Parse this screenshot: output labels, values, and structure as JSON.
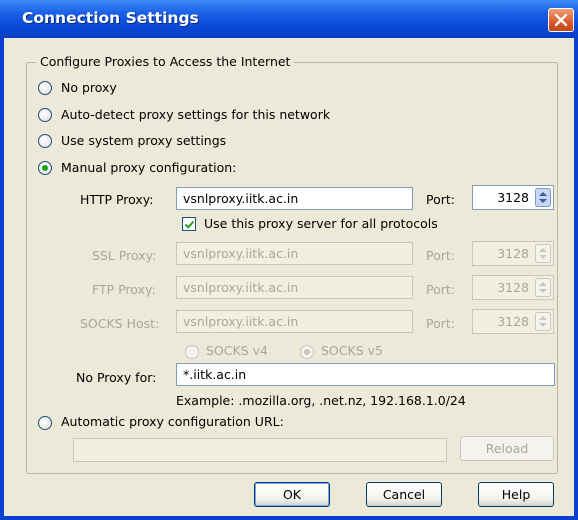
{
  "window": {
    "title": "Connection Settings"
  },
  "group": {
    "legend": "Configure Proxies to Access the Internet"
  },
  "radios": {
    "no_proxy": "No proxy",
    "auto_detect": "Auto-detect proxy settings for this network",
    "system": "Use system proxy settings",
    "manual": "Manual proxy configuration:",
    "auto_url": "Automatic proxy configuration URL:"
  },
  "http": {
    "label": "HTTP Proxy:",
    "value": "vsnlproxy.iitk.ac.in",
    "port_label": "Port:",
    "port": "3128"
  },
  "use_all": {
    "label": "Use this proxy server for all protocols",
    "checked": true
  },
  "ssl": {
    "label": "SSL Proxy:",
    "value": "vsnlproxy.iitk.ac.in",
    "port_label": "Port:",
    "port": "3128"
  },
  "ftp": {
    "label": "FTP Proxy:",
    "value": "vsnlproxy.iitk.ac.in",
    "port_label": "Port:",
    "port": "3128"
  },
  "socks": {
    "label": "SOCKS Host:",
    "value": "vsnlproxy.iitk.ac.in",
    "port_label": "Port:",
    "port": "3128",
    "v4": "SOCKS v4",
    "v5": "SOCKS v5"
  },
  "no_proxy_for": {
    "label": "No Proxy for:",
    "value": "*.iitk.ac.in",
    "example": "Example: .mozilla.org, .net.nz, 192.168.1.0/24"
  },
  "auto_url": {
    "value": "",
    "reload": "Reload"
  },
  "buttons": {
    "ok": "OK",
    "cancel": "Cancel",
    "help": "Help"
  },
  "colors": {
    "titlebar": "#0a48d6",
    "dialog_bg": "#ece9d8",
    "close": "#d85a2c",
    "check_green": "#21a121"
  }
}
